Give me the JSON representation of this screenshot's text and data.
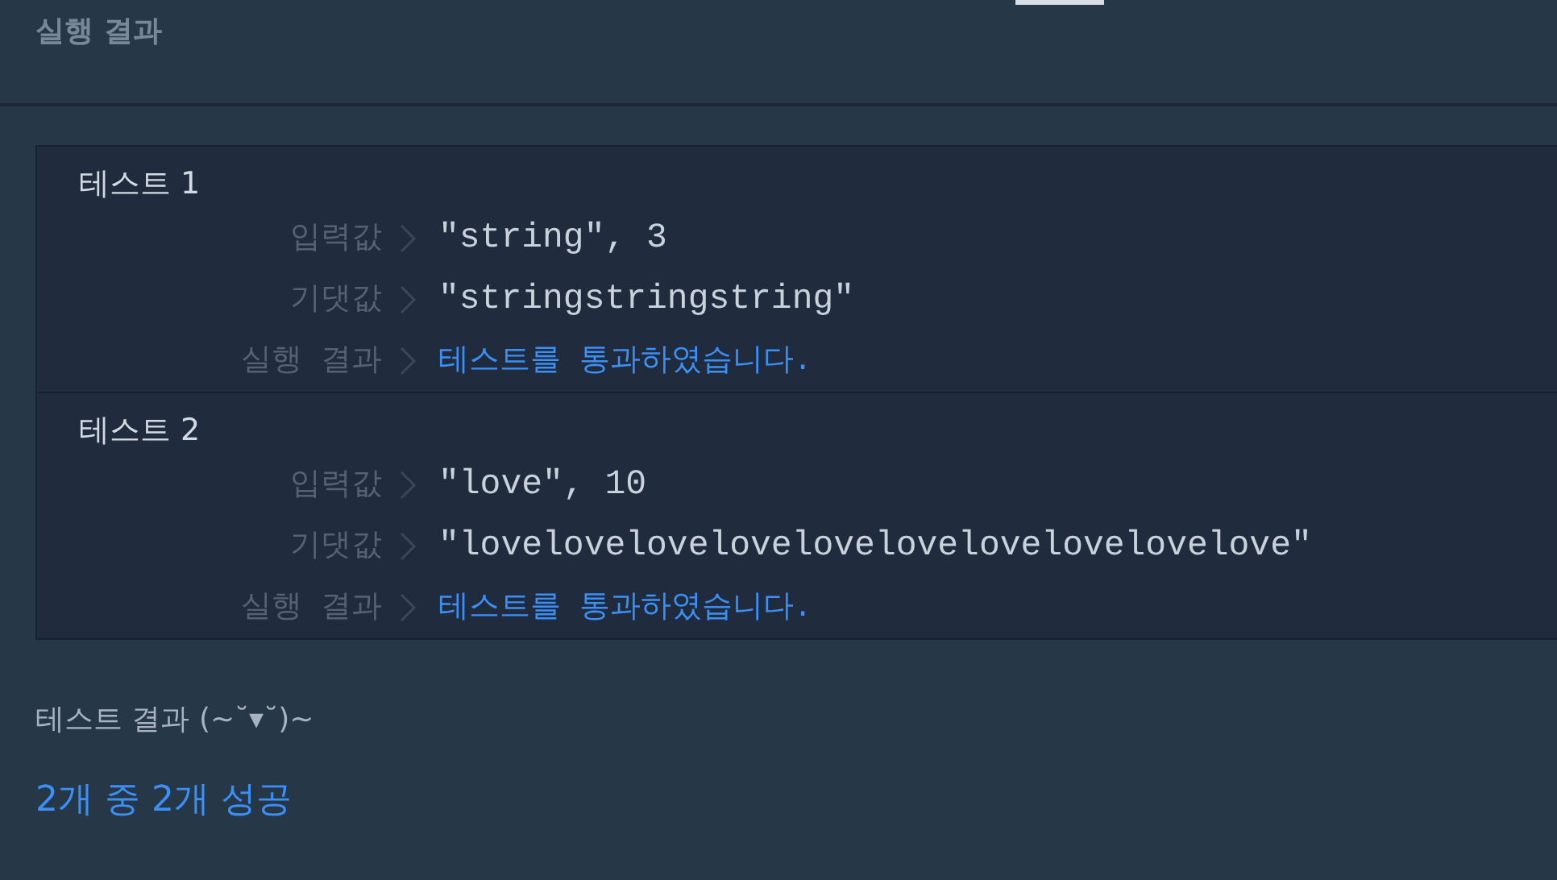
{
  "title": "실행 결과",
  "tests": [
    {
      "title": "테스트 1",
      "rows": [
        {
          "label": "입력값",
          "value": "\"string\", 3",
          "kind": "value"
        },
        {
          "label": "기댓값",
          "value": "\"stringstringstring\"",
          "kind": "value"
        },
        {
          "label": "실행 결과",
          "value": "테스트를 통과하였습니다.",
          "kind": "pass"
        }
      ]
    },
    {
      "title": "테스트 2",
      "rows": [
        {
          "label": "입력값",
          "value": "\"love\", 10",
          "kind": "value"
        },
        {
          "label": "기댓값",
          "value": "\"lovelovelovelovelovelovelovelovelovelove\"",
          "kind": "value"
        },
        {
          "label": "실행 결과",
          "value": "테스트를 통과하였습니다.",
          "kind": "pass"
        }
      ]
    }
  ],
  "summary_title": "테스트 결과 (~˘▾˘)~",
  "summary": "2개 중 2개 성공"
}
